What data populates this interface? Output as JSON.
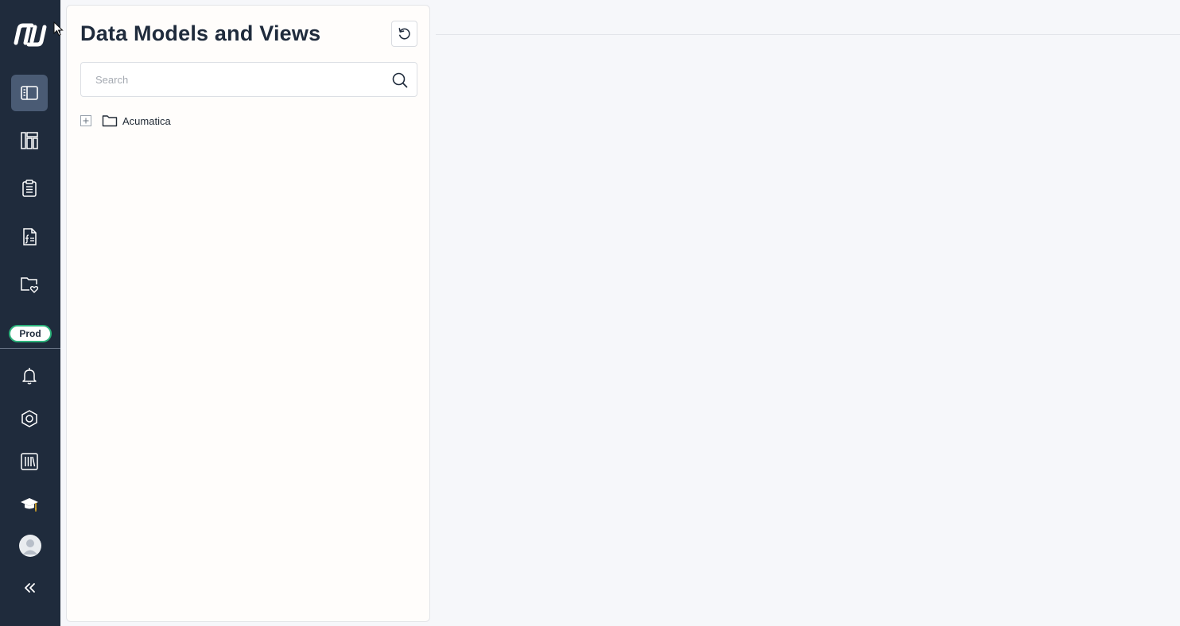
{
  "panel": {
    "title": "Data Models and Views",
    "search": {
      "placeholder": "Search",
      "value": ""
    },
    "tree": [
      {
        "label": "Acumatica",
        "expanded": false
      }
    ]
  },
  "sidebar": {
    "env_badge": "Prod",
    "items": [
      {
        "icon": "data-models-icon",
        "active": true
      },
      {
        "icon": "dashboards-icon",
        "active": false
      },
      {
        "icon": "reports-icon",
        "active": false
      },
      {
        "icon": "formulas-icon",
        "active": false
      },
      {
        "icon": "favorites-folder-icon",
        "active": false
      },
      {
        "icon": "bell-icon",
        "active": false
      },
      {
        "icon": "settings-hexagon-icon",
        "active": false
      },
      {
        "icon": "library-icon",
        "active": false
      },
      {
        "icon": "graduation-cap-icon",
        "active": false
      },
      {
        "icon": "user-avatar-icon",
        "active": false
      },
      {
        "icon": "collapse-icon",
        "active": false
      }
    ]
  },
  "colors": {
    "sidebar_bg": "#1f2b3c",
    "active_item_bg": "#4a5b74",
    "env_badge_border": "#2cb37b",
    "title_text": "#1f2b3c"
  }
}
